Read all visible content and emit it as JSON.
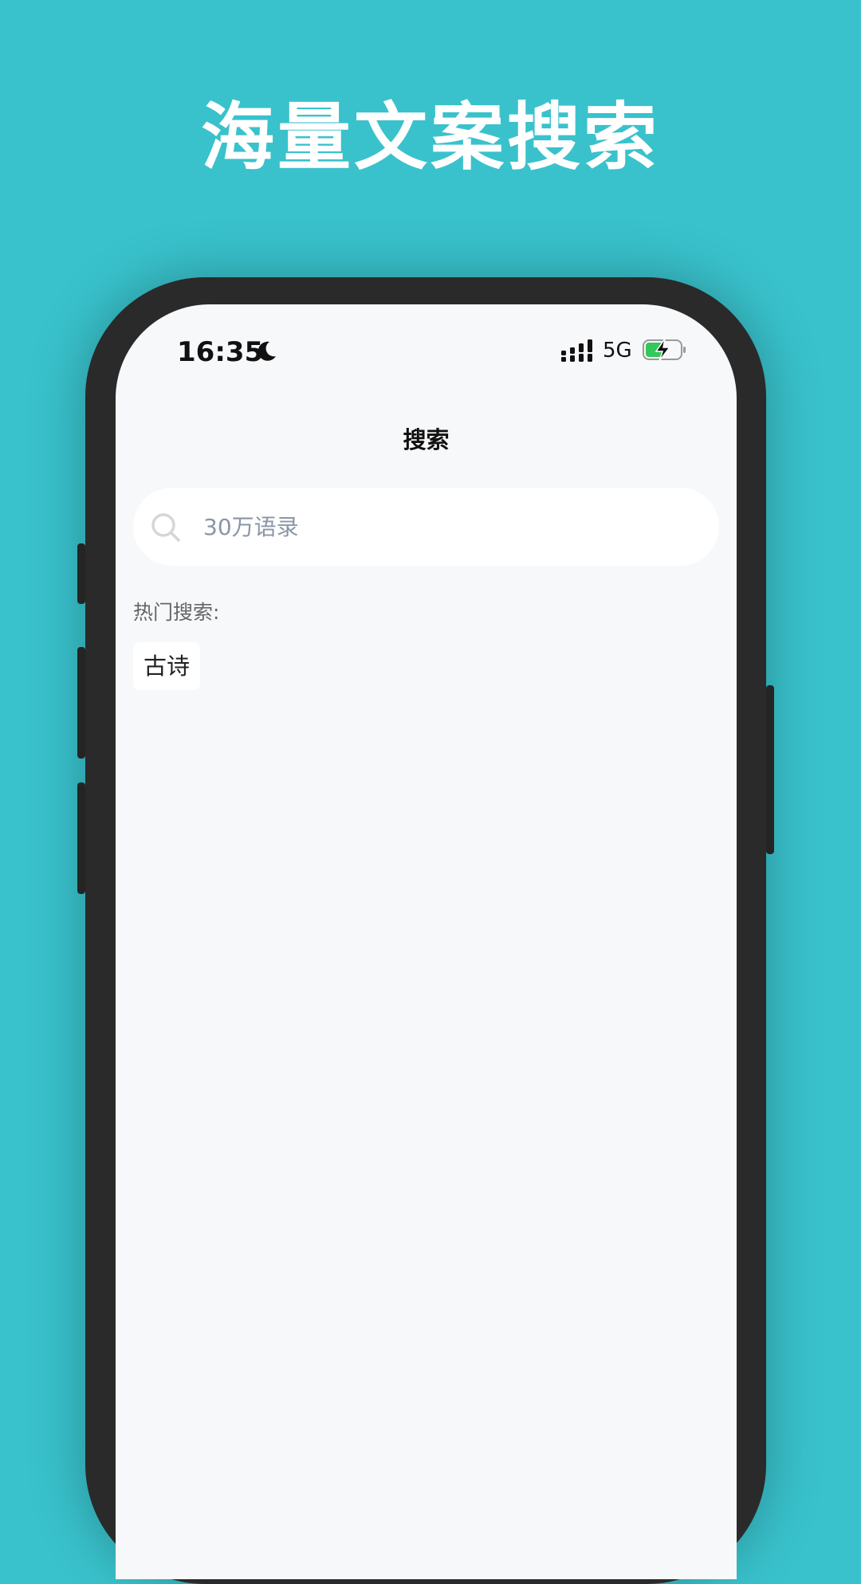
{
  "promo": {
    "headline": "海量文案搜索"
  },
  "status_bar": {
    "time": "16:35",
    "network": "5G",
    "icons": {
      "focus": "moon-icon",
      "signal": "signal-bars-icon",
      "battery": "battery-charging-icon"
    },
    "colors": {
      "battery_fill": "#34c759"
    }
  },
  "page": {
    "title": "搜索"
  },
  "search": {
    "value": "",
    "placeholder": "30万语录",
    "icon": "search-icon"
  },
  "hot_search": {
    "label": "热门搜索:",
    "tags": [
      "古诗"
    ]
  },
  "colors": {
    "background": "#39c2cc",
    "phone_frame": "#2a2a2a",
    "screen": "#f7f8fa",
    "placeholder": "#8a96a8"
  }
}
